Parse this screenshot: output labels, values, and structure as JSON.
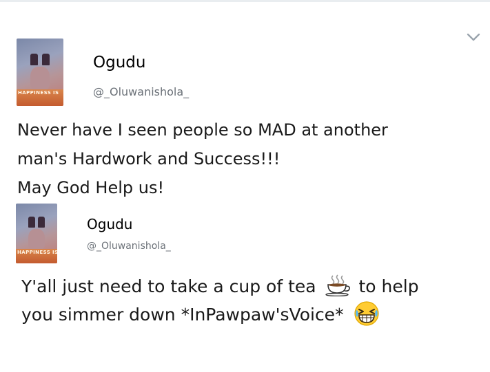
{
  "tweets": [
    {
      "name": "Ogudu",
      "handle": "@_Oluwanishola_",
      "avatar_text": "HAPPINESS IS",
      "lines": [
        "Never have I seen people so MAD at another",
        "man's Hardwork and Success!!!",
        "May God Help us!"
      ]
    },
    {
      "name": "Ogudu",
      "handle": "@_Oluwanishola_",
      "avatar_text": "HAPPINESS IS",
      "lines": [
        "Y'all just need to take a cup of tea",
        "to help",
        "you simmer down *InPawpaw'sVoice*"
      ],
      "emojis": [
        "hot-beverage-icon",
        "grinning-squinting-face-icon"
      ]
    }
  ],
  "icons": {
    "menu": "chevron-down-icon"
  },
  "colors": {
    "text": "#1a1a1a",
    "handle": "#6b7178",
    "avatar_band": "#c45b2f",
    "emoji_yellow": "#ffcc33"
  }
}
